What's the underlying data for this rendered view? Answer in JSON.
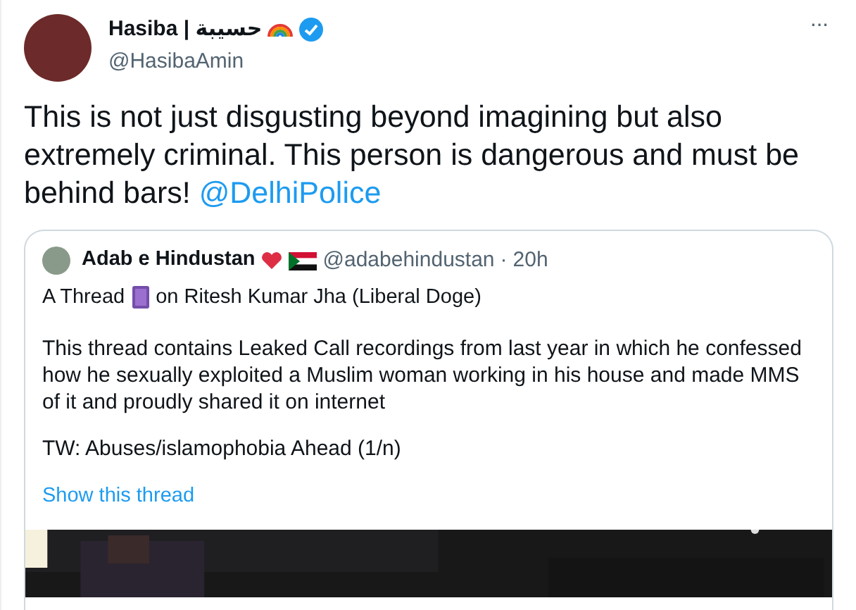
{
  "author": {
    "name": "Hasiba | حسيبة",
    "verified": true,
    "handle": "@HasibaAmin"
  },
  "more_button": "···",
  "tweet_text": "This is not just disgusting beyond imagining but also extremely criminal. This person is dangerous and must be behind bars!",
  "mention": "@DelhiPolice",
  "quoted_tweet": {
    "author_name": "Adab e Hindustan",
    "handle": "@adabehindustan",
    "separator": "·",
    "time": "20h",
    "thread_title_start": "A Thread",
    "thread_title_end": "on Ritesh Kumar Jha (Liberal Doge)",
    "paragraphs": [
      "This thread contains Leaked Call recordings from last year in which he confessed how he sexually exploited a Muslim woman working in his house and made MMS of it and proudly shared it on internet",
      "TW: Abuses/islamophobia Ahead (1/n)"
    ],
    "show_thread": "Show this thread"
  }
}
